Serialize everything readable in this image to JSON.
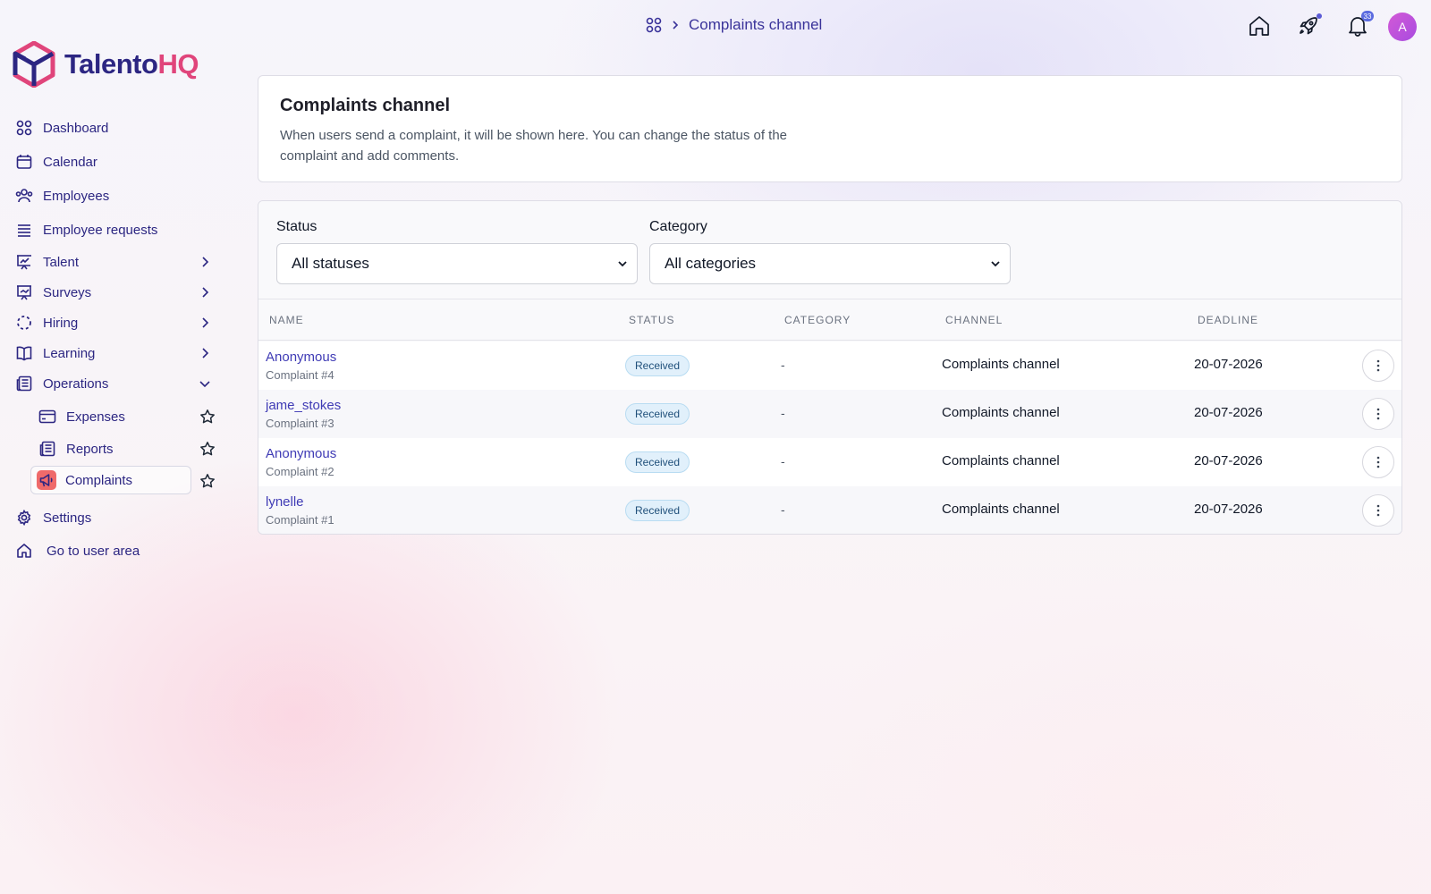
{
  "brand": {
    "name_part1": "Talento",
    "name_part2": "HQ",
    "color_primary": "#2c2682",
    "color_accent": "#e0457b"
  },
  "breadcrumb": {
    "icon": "grid-icon",
    "current": "Complaints channel"
  },
  "topbar": {
    "icons": [
      "home-icon",
      "rocket-icon",
      "bell-icon"
    ],
    "notification_count": "33",
    "avatar_initial": "A"
  },
  "sidebar": {
    "items": [
      {
        "label": "Dashboard",
        "icon": "dashboard-icon"
      },
      {
        "label": "Calendar",
        "icon": "calendar-icon"
      },
      {
        "label": "Employees",
        "icon": "users-icon"
      },
      {
        "label": "Employee requests",
        "icon": "list-icon"
      },
      {
        "label": "Talent",
        "icon": "presentation-chart-icon",
        "expandable": true
      },
      {
        "label": "Surveys",
        "icon": "presentation-icon",
        "expandable": true
      },
      {
        "label": "Hiring",
        "icon": "dashed-circle-icon",
        "expandable": true
      },
      {
        "label": "Learning",
        "icon": "book-icon",
        "expandable": true
      },
      {
        "label": "Operations",
        "icon": "newspaper-icon",
        "expanded": true
      }
    ],
    "operations_children": [
      {
        "label": "Expenses",
        "icon": "credit-card-icon"
      },
      {
        "label": "Reports",
        "icon": "newspaper-icon"
      },
      {
        "label": "Complaints",
        "icon": "megaphone-icon",
        "active": true
      }
    ],
    "footer": [
      {
        "label": "Settings",
        "icon": "gear-icon"
      },
      {
        "label": "Go to user area",
        "icon": "home-icon"
      }
    ]
  },
  "intro": {
    "title": "Complaints channel",
    "description": "When users send a complaint, it will be shown here. You can change the status of the complaint and add comments."
  },
  "filters": {
    "status_label": "Status",
    "status_value": "All statuses",
    "category_label": "Category",
    "category_value": "All categories"
  },
  "table": {
    "headers": [
      "NAME",
      "STATUS",
      "CATEGORY",
      "CHANNEL",
      "DEADLINE"
    ],
    "rows": [
      {
        "name": "Anonymous",
        "sub": "Complaint #4",
        "status": "Received",
        "category": "-",
        "channel": "Complaints channel",
        "deadline": "20-07-2026"
      },
      {
        "name": "jame_stokes",
        "sub": "Complaint #3",
        "status": "Received",
        "category": "-",
        "channel": "Complaints channel",
        "deadline": "20-07-2026"
      },
      {
        "name": "Anonymous",
        "sub": "Complaint #2",
        "status": "Received",
        "category": "-",
        "channel": "Complaints channel",
        "deadline": "20-07-2026"
      },
      {
        "name": "lynelle",
        "sub": "Complaint #1",
        "status": "Received",
        "category": "-",
        "channel": "Complaints channel",
        "deadline": "20-07-2026"
      }
    ]
  }
}
